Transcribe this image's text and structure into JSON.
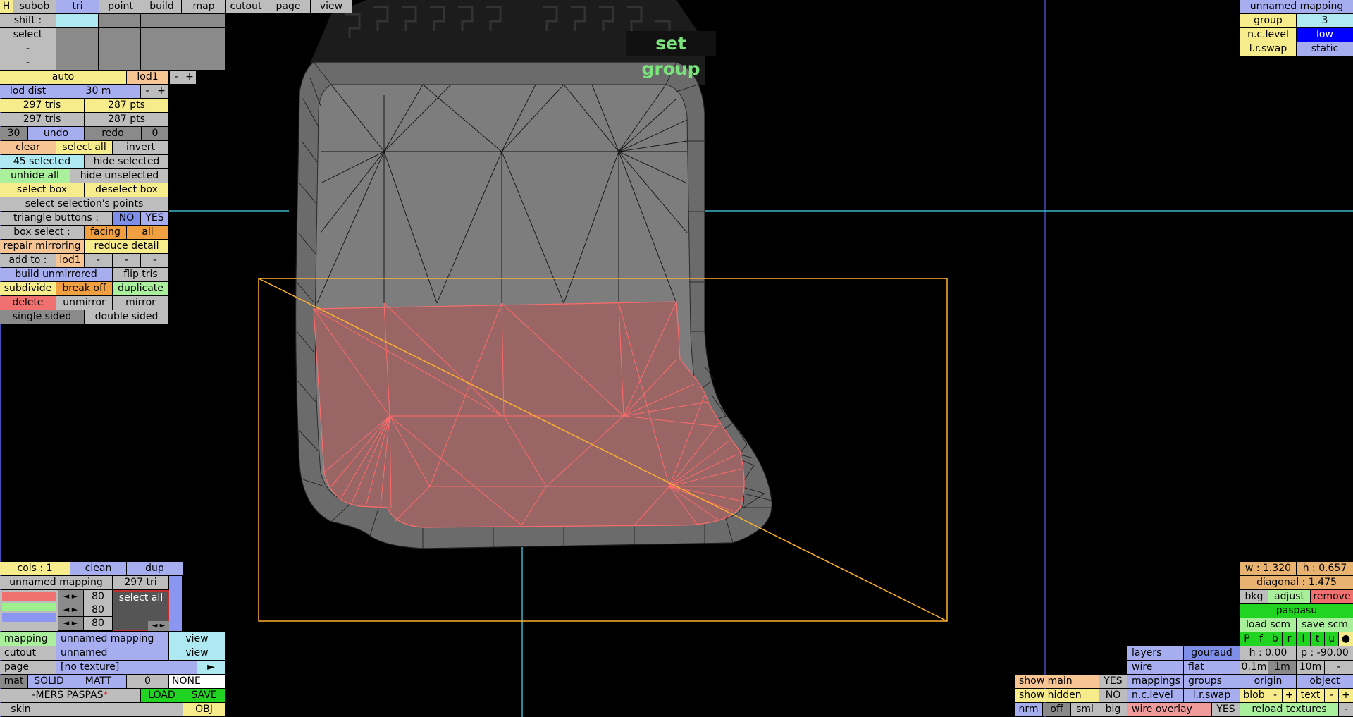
{
  "top_tabs": {
    "h": "H",
    "subob": "subob",
    "tri": "tri",
    "point": "point",
    "build": "build",
    "map": "map",
    "cutout": "cutout",
    "page": "page",
    "view": "view"
  },
  "left": {
    "shift": "shift :",
    "select": "select",
    "dash": "-",
    "auto": "auto",
    "lod1": "lod1",
    "minus": "-",
    "plus": "+",
    "lod_dist": "lod dist",
    "lod_dist_val": "30 m",
    "tris1": "297 tris",
    "pts1": "287 pts",
    "tris2": "297 tris",
    "pts2": "287 pts",
    "undo_count": "30",
    "undo": "undo",
    "redo": "redo",
    "redo_count": "0",
    "clear": "clear",
    "select_all": "select all",
    "invert": "invert",
    "selected": "45 selected",
    "hide_selected": "hide selected",
    "unhide_all": "unhide all",
    "hide_unselected": "hide unselected",
    "select_box": "select box",
    "deselect_box": "deselect box",
    "select_sel_points": "select selection's points",
    "triangle_buttons": "triangle buttons :",
    "no": "NO",
    "yes": "YES",
    "box_select": "box select :",
    "facing": "facing",
    "all": "all",
    "repair_mirroring": "repair mirroring",
    "reduce_detail": "reduce detail",
    "add_to": "add to :",
    "add_lod1": "lod1",
    "build_unmirrored": "build unmirrored",
    "flip_tris": "flip tris",
    "subdivide": "subdivide",
    "break_off": "break off",
    "duplicate": "duplicate",
    "delete": "delete",
    "unmirror": "unmirror",
    "mirror": "mirror",
    "single_sided": "single sided",
    "double_sided": "double sided"
  },
  "bottom_left": {
    "cols": "cols : 1",
    "clean": "clean",
    "dup": "dup",
    "mapping_name": "unnamed mapping",
    "tri_count": "297 tri",
    "slider_vals": [
      "80",
      "80",
      "80"
    ],
    "select_all": "select all",
    "mapping_label": "mapping",
    "mapping_value": "unnamed mapping",
    "view": "view",
    "cutout_label": "cutout",
    "cutout_value": "unnamed",
    "page_label": "page",
    "page_value": "[no texture]",
    "arrow": "►",
    "mat": "mat",
    "solid": "SOLID",
    "matt": "MATT",
    "zero": "0",
    "none": "NONE",
    "file": "-MERS PASPAS",
    "star": "*",
    "load": "LOAD",
    "save": "SAVE",
    "skin": "skin",
    "obj": "OBJ"
  },
  "top_right": {
    "title": "unnamed mapping",
    "group": "group",
    "group_val": "3",
    "nclevel": "n.c.level",
    "nclevel_val": "low",
    "lrswap": "l.r.swap",
    "lrswap_val": "static"
  },
  "bottom_right": {
    "w": "w : 1.320",
    "h": "h : 0.657",
    "diagonal": "diagonal : 1.475",
    "bkg": "bkg",
    "adjust": "adjust",
    "remove": "remove",
    "paspasu": "paspasu",
    "load_scm": "load scm",
    "save_scm": "save scm",
    "letters": [
      "P",
      "f",
      "b",
      "r",
      "l",
      "t",
      "u",
      "●"
    ],
    "layers": "layers",
    "gouraud": "gouraud",
    "h0": "h : 0.00",
    "p90": "p : -90.00",
    "wire": "wire",
    "flat": "flat",
    "m01": "0.1m",
    "m1": "1m",
    "m10": "10m",
    "dash": "-",
    "show_main": "show main",
    "yes": "YES",
    "mappings": "mappings",
    "groups": "groups",
    "origin": "origin",
    "object": "object",
    "show_hidden": "show hidden",
    "no": "NO",
    "nclevel": "n.c.level",
    "lrswap": "l.r.swap",
    "blob": "blob",
    "minus": "-",
    "plus": "+",
    "text": "text",
    "nrm": "nrm",
    "off": "off",
    "sml": "sml",
    "big": "big",
    "wire_overlay": "wire overlay",
    "reload": "reload textures"
  },
  "tooltip": "set group"
}
